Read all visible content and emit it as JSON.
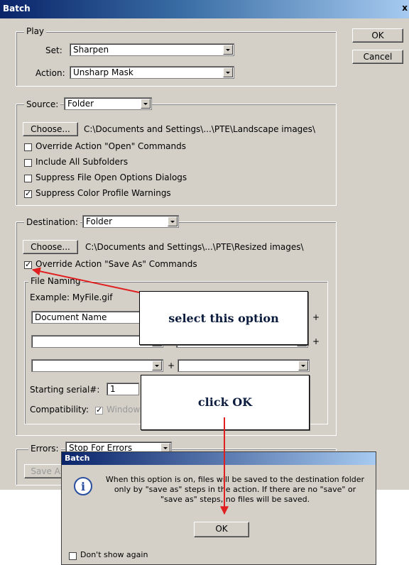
{
  "window": {
    "title": "Batch",
    "close": "x"
  },
  "buttons": {
    "ok": "OK",
    "cancel": "Cancel"
  },
  "play": {
    "legend": "Play",
    "set_label": "Set:",
    "set_value": "Sharpen",
    "action_label": "Action:",
    "action_value": "Unsharp Mask"
  },
  "source": {
    "label": "Source:",
    "value": "Folder",
    "choose": "Choose...",
    "path": "C:\\Documents and Settings\\...\\PTE\\Landscape images\\",
    "checks": [
      {
        "label": "Override Action \"Open\" Commands",
        "checked": false
      },
      {
        "label": "Include All Subfolders",
        "checked": false
      },
      {
        "label": "Suppress File Open Options Dialogs",
        "checked": false
      },
      {
        "label": "Suppress Color Profile Warnings",
        "checked": true
      }
    ]
  },
  "destination": {
    "label": "Destination:",
    "value": "Folder",
    "choose": "Choose...",
    "path": "C:\\Documents and Settings\\...\\PTE\\Resized images\\",
    "override_label": "Override Action \"Save As\" Commands",
    "override_checked": true
  },
  "naming": {
    "legend": "File Naming",
    "example": "Example: MyFile.gif",
    "field1": "Document Name",
    "plus": "+",
    "serial_label": "Starting serial#:",
    "serial_value": "1",
    "compat_label": "Compatibility:",
    "compat_option": "Windows"
  },
  "errors": {
    "label": "Errors:",
    "value": "Stop For Errors",
    "save_as": "Save As..."
  },
  "callouts": {
    "select": "select this option",
    "click": "click OK"
  },
  "alert": {
    "title": "Batch",
    "message": "When this option is on, files will be saved to the destination folder only by \"save as\" steps in the action. If there are no \"save\" or \"save as\" steps, no files will be saved.",
    "ok": "OK",
    "dont_show": "Don't show again",
    "icon": "info-icon"
  },
  "colors": {
    "face": "#d4d0c8",
    "title_start": "#0a246a",
    "title_end": "#a6caf0",
    "arrow": "#e02020"
  }
}
